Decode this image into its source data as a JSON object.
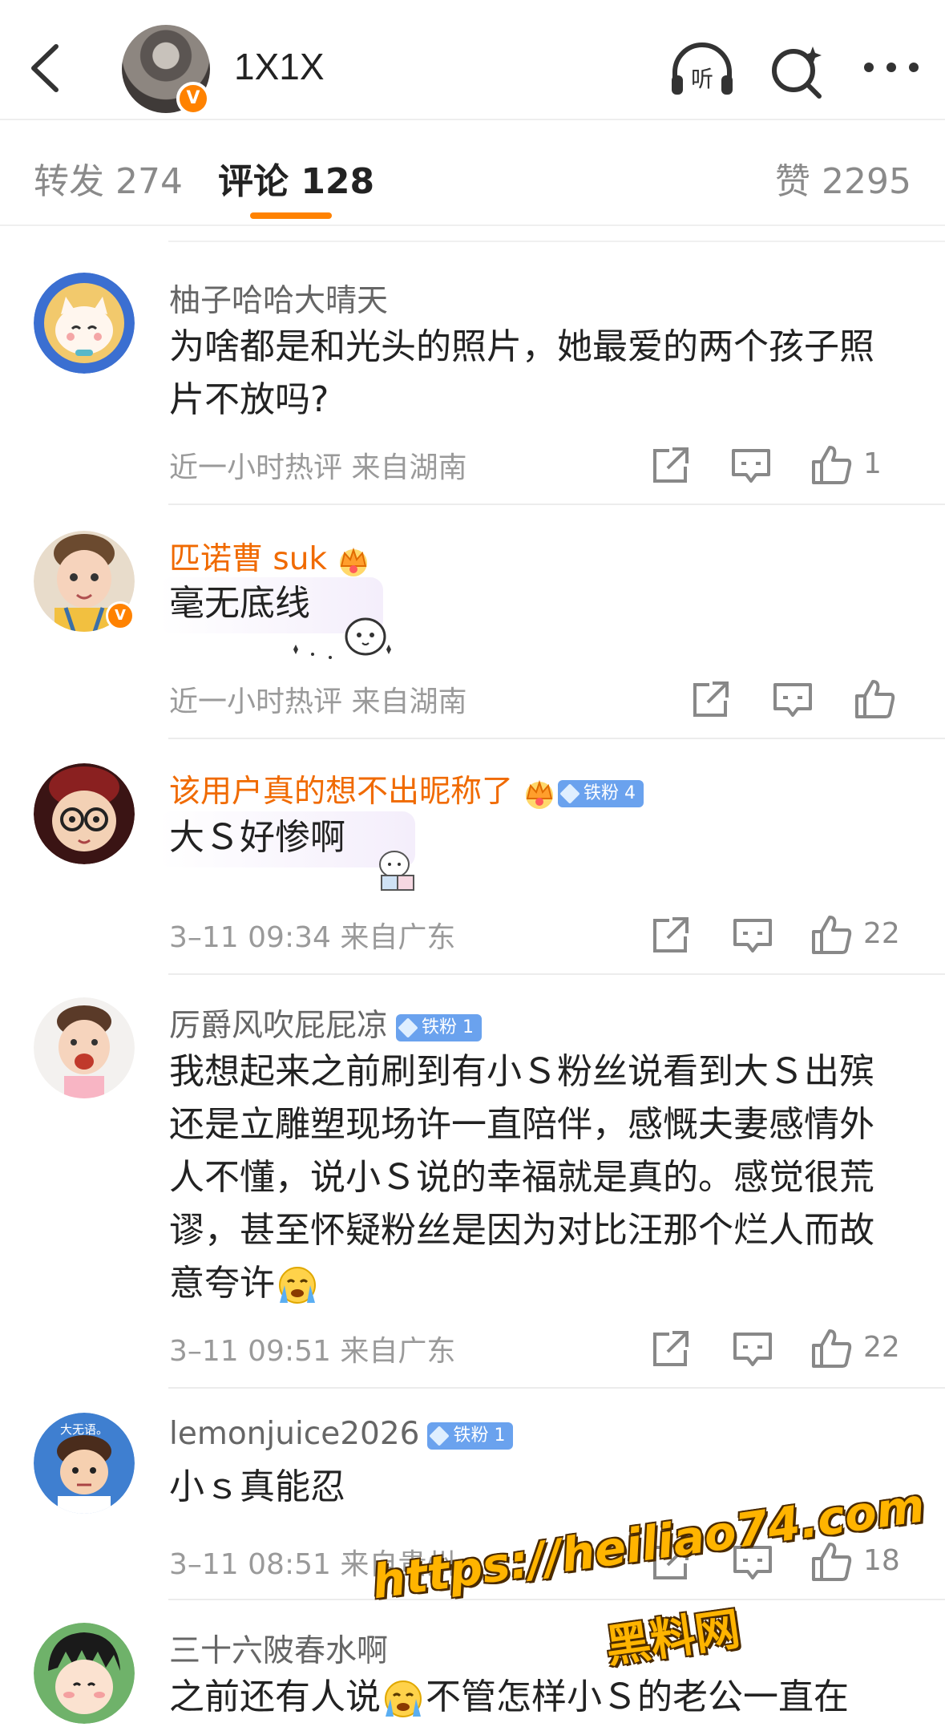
{
  "header": {
    "title": "1X1X",
    "verified_mark": "V",
    "icons": [
      "back-icon",
      "listen-icon",
      "search-icon",
      "more-icon"
    ],
    "listen_label": "听"
  },
  "tabs": {
    "repost": "转发 274",
    "comments": "评论 128",
    "likes": "赞 2295"
  },
  "colors": {
    "accent": "#ff8200",
    "vip_name": "#f06a00",
    "fan_badge": "#6aa2ee"
  },
  "comments": [
    {
      "name": "柚子哈哈大晴天",
      "text": "为啥都是和光头的照片，她最爱的两个孩子照片不放吗?",
      "meta": "近一小时热评  来自湖南",
      "likes": "1"
    },
    {
      "name": "匹诺曹 suk",
      "verified_mark": "V",
      "text": "毫无底线",
      "meta": "近一小时热评  来自湖南",
      "likes": ""
    },
    {
      "name": "该用户真的想不出昵称了",
      "badge": "铁粉 4",
      "text": "大Ｓ好惨啊",
      "meta": "3–11 09:34  来自广东",
      "likes": "22"
    },
    {
      "name": "厉爵风吹屁屁凉",
      "badge": "铁粉 1",
      "text": "我想起来之前刷到有小Ｓ粉丝说看到大Ｓ出殡还是立雕塑现场许一直陪伴，感慨夫妻感情外人不懂，说小Ｓ说的幸福就是真的。感觉很荒谬，甚至怀疑粉丝是因为对比汪那个烂人而故意夸许",
      "meta": "3–11 09:51  来自广东",
      "likes": "22"
    },
    {
      "name": "lemonjuice2026",
      "badge": "铁粉 1",
      "avatar_text": "大无语。",
      "text": "小ｓ真能忍",
      "meta": "3–11 08:51  来自贵州",
      "likes": "18"
    },
    {
      "name": "三十六陂春水啊",
      "text": "之前还有人说",
      "text_after": "不管怎样小Ｓ的老公一直在"
    }
  ],
  "watermark": {
    "url": "https://heiliao74.com",
    "site": "黑料网"
  }
}
